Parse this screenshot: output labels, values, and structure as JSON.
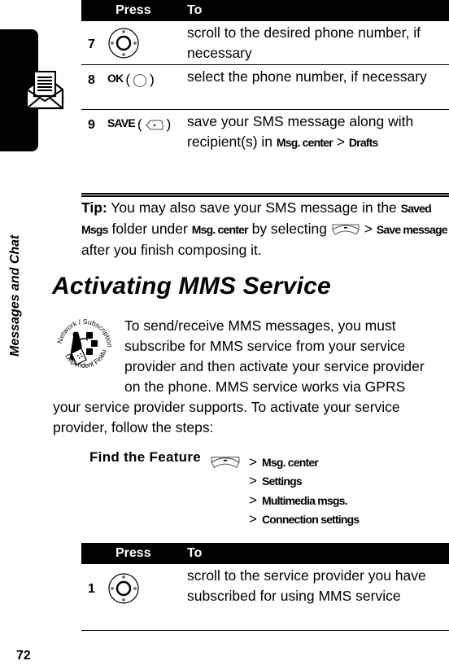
{
  "side_tab": {
    "label": "Messages and Chat",
    "icon": "open-envelope-icon"
  },
  "page_number": "72",
  "table1": {
    "headers": {
      "press": "Press",
      "to": "To"
    },
    "rows": [
      {
        "step": "7",
        "press_icon": "navigation-key-icon",
        "press_label": "",
        "to": "scroll to the desired phone number, if necessary"
      },
      {
        "step": "8",
        "press_label": "OK",
        "press_icon": "center-select-key-icon",
        "to": "select the phone number, if necessary"
      },
      {
        "step": "9",
        "press_label": "SAVE",
        "press_icon": "left-soft-key-icon",
        "to_text": "save your SMS message along with recipient(s) in ",
        "to_kw1": "Msg. center",
        "to_sep": " > ",
        "to_kw2": "Drafts"
      }
    ]
  },
  "tip": {
    "label": "Tip:",
    "text1": " You may also save your SMS message in the ",
    "kw1": "Saved Msgs",
    "text2": " folder under ",
    "kw2": "Msg. center",
    "text3": " by selecting ",
    "icon": "menu-key-icon",
    "text4": " > ",
    "kw3": "Save message",
    "text5": " after you finish composing it."
  },
  "section": {
    "heading": "Activating MMS Service",
    "badge_icon": "network-subscription-dependent-feature-icon",
    "badge_text": "Network / Subscription Dependent Feature",
    "lines": [
      "To send/receive MMS messages, you must",
      "subscribe for MMS service from your service",
      "provider and then activate your service provider",
      "on the phone. MMS service works via GPRS"
    ],
    "lines_full": [
      "your service provider supports. To activate your service",
      "provider, follow the steps:"
    ]
  },
  "find_feature": {
    "label": "Find the Feature",
    "icon": "menu-key-icon",
    "path": [
      "Msg. center",
      "Settings",
      "Multimedia msgs.",
      "Connection settings"
    ]
  },
  "table2": {
    "headers": {
      "press": "Press",
      "to": "To"
    },
    "rows": [
      {
        "step": "1",
        "press_icon": "navigation-key-icon",
        "to": "scroll to the service provider you have subscribed for using MMS service"
      }
    ]
  }
}
